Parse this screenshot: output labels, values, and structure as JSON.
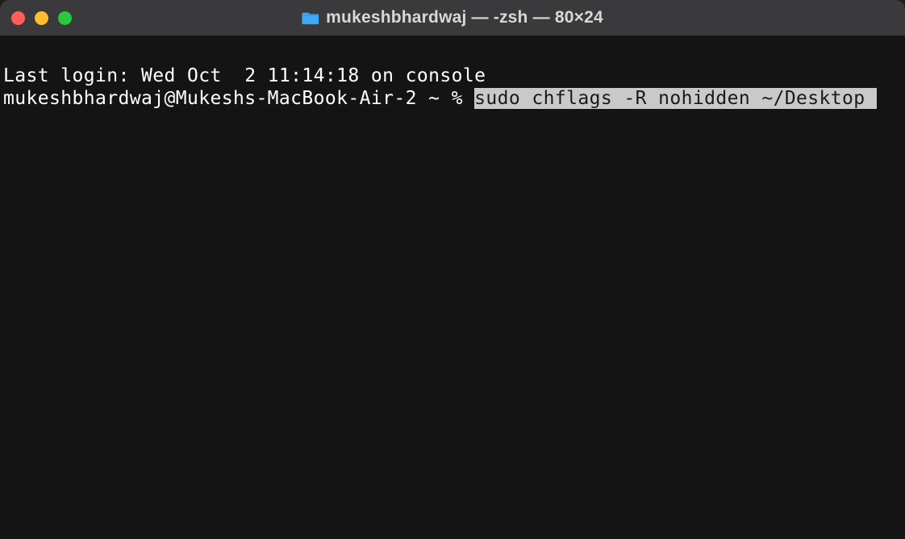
{
  "window": {
    "title": "mukeshbhardwaj — -zsh — 80×24"
  },
  "terminal": {
    "last_login_line": "Last login: Wed Oct  2 11:14:18 on console",
    "prompt": "mukeshbhardwaj@Mukeshs-MacBook-Air-2 ~ % ",
    "command_selected": "sudo chflags -R nohidden ~/Desktop"
  },
  "colors": {
    "titlebar": "#3a3a3c",
    "bg": "#141414",
    "fg": "#ffffff",
    "selection_bg": "#c9c9c9",
    "selection_fg": "#1a1a1a"
  }
}
